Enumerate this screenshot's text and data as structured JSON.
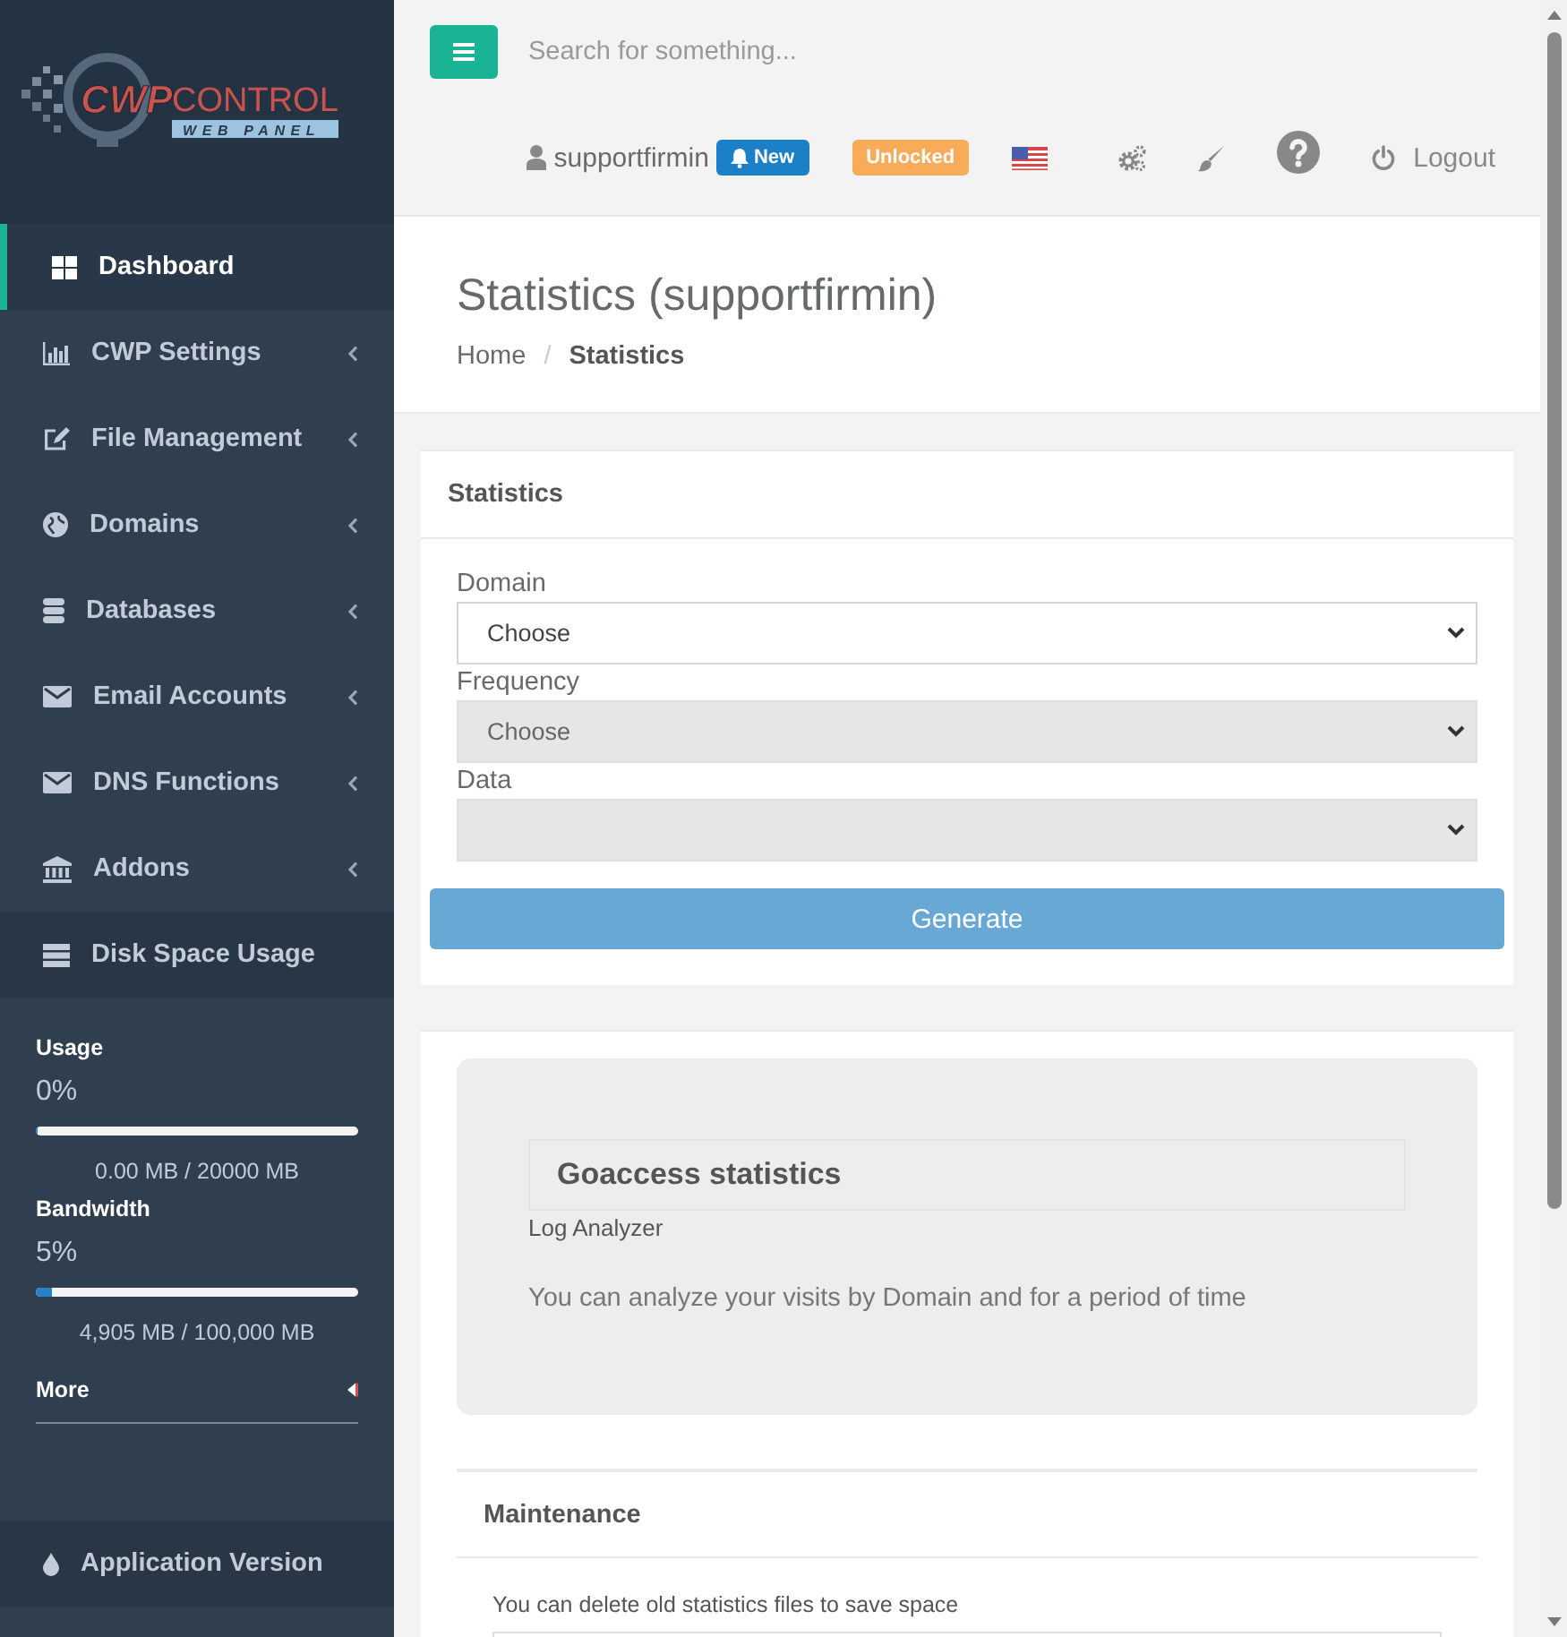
{
  "sidebar": {
    "logo": {
      "mark": "CWP",
      "name": "CONTROL",
      "tagline": "WEB PANEL"
    },
    "menu": [
      {
        "label": "Dashboard",
        "selected": true,
        "submenu": false
      },
      {
        "label": "CWP Settings",
        "selected": false,
        "submenu": true
      },
      {
        "label": "File Management",
        "selected": false,
        "submenu": true
      },
      {
        "label": "Domains",
        "selected": false,
        "submenu": true
      },
      {
        "label": "Databases",
        "selected": false,
        "submenu": true
      },
      {
        "label": "Email Accounts",
        "selected": false,
        "submenu": true
      },
      {
        "label": "DNS Functions",
        "selected": false,
        "submenu": true
      },
      {
        "label": "Addons",
        "selected": false,
        "submenu": true
      }
    ],
    "disk_panel": {
      "title": "Disk Space Usage",
      "meters": [
        {
          "label": "Usage",
          "percent": "0%",
          "level": 0,
          "reading": "0.00 MB / 20000 MB"
        },
        {
          "label": "Bandwidth",
          "percent": "5%",
          "level": 0.05,
          "reading": "4,905 MB / 100,000 MB"
        }
      ],
      "more": "More"
    },
    "footer_item": {
      "label": "Application Version"
    }
  },
  "top_bar": {
    "search": {
      "placeholder": "Search for something..."
    },
    "user": "supportfirmin",
    "badges": [
      {
        "kind": "notification",
        "label": "New",
        "color": "#1c80c8"
      },
      {
        "kind": "status",
        "label": "Unlocked",
        "color": "#f8ac59"
      }
    ],
    "logout": "Logout"
  },
  "page_header": {
    "title": "Statistics (supportfirmin)",
    "breadcrumb": {
      "separator": "/",
      "items": [
        {
          "label": "Home",
          "selected": false
        },
        {
          "label": "Statistics",
          "selected": true
        }
      ]
    }
  },
  "statistics_card": {
    "title": "Statistics",
    "fields": [
      {
        "label": "Domain",
        "value": "Choose",
        "disabled": false
      },
      {
        "label": "Frequency",
        "value": "Choose",
        "disabled": true
      },
      {
        "label": "Data",
        "disabled": true
      }
    ],
    "button": "Generate"
  },
  "goaccess_card": {
    "title": "Goaccess statistics",
    "subtitle": "Log Analyzer",
    "description": "You can analyze your visits by Domain and for a period of time"
  },
  "maintenance": {
    "title": "Maintenance",
    "description": "You can delete old statistics files to save space"
  }
}
